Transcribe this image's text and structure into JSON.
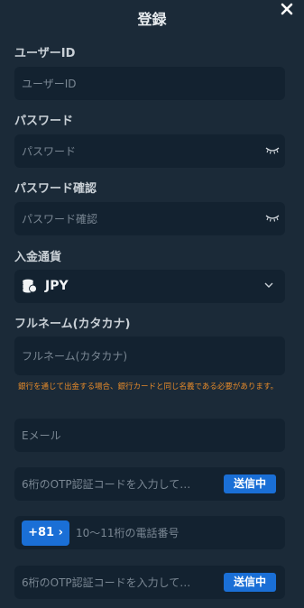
{
  "header": {
    "title": "登録",
    "close_icon": "close-icon"
  },
  "form": {
    "user_id": {
      "label": "ユーザーID",
      "placeholder": "ユーザーID",
      "value": ""
    },
    "password": {
      "label": "パスワード",
      "placeholder": "パスワード",
      "value": "",
      "toggle_icon": "eye-closed-icon"
    },
    "password_confirm": {
      "label": "パスワード確認",
      "placeholder": "パスワード確認",
      "value": "",
      "toggle_icon": "eye-closed-icon"
    },
    "currency": {
      "label": "入金通貨",
      "selected": "JPY",
      "icon": "coins-icon",
      "dropdown_icon": "chevron-down-icon"
    },
    "katakana_name": {
      "label": "フルネーム(カタカナ)",
      "placeholder": "フルネーム(カタカナ)",
      "value": ""
    },
    "notice": "銀行を通じて出金する場合、銀行カードと同じ名義である必要があります。",
    "email": {
      "placeholder": "Eメール",
      "value": ""
    },
    "email_otp": {
      "placeholder": "6桁のOTP認証コードを入力して…",
      "value": "",
      "button_label": "送信中"
    },
    "phone": {
      "country_code": "+81",
      "placeholder": "10～11桁の電話番号",
      "value": ""
    },
    "phone_otp": {
      "placeholder": "6桁のOTP認証コードを入力して…",
      "value": "",
      "button_label": "送信中"
    }
  },
  "colors": {
    "background": "#1b2a38",
    "field": "#132230",
    "accent": "#1a6fd6",
    "notice": "#e58a2a"
  }
}
